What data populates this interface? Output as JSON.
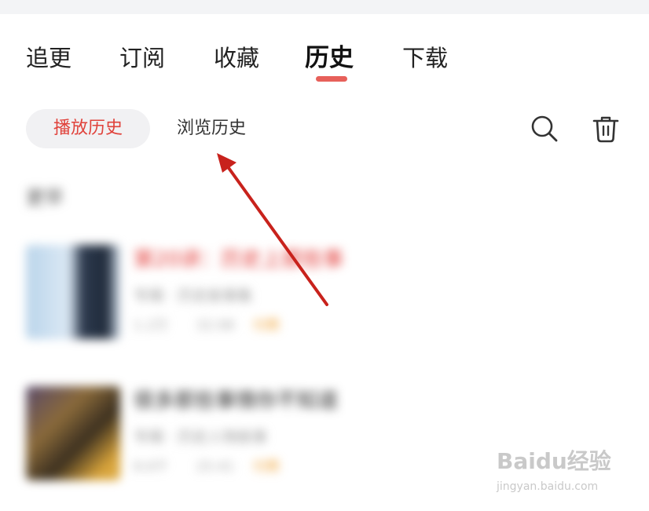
{
  "top_tabs": [
    {
      "label": "追更",
      "active": false
    },
    {
      "label": "订阅",
      "active": false
    },
    {
      "label": "收藏",
      "active": false
    },
    {
      "label": "历史",
      "active": true
    },
    {
      "label": "下载",
      "active": false
    }
  ],
  "sub_tabs": [
    {
      "label": "播放历史",
      "active": true
    },
    {
      "label": "浏览历史",
      "active": false
    }
  ],
  "toolbar": {
    "search_icon": "search-icon",
    "delete_icon": "trash-icon"
  },
  "history_section": {
    "label": "更早"
  },
  "history_items": [
    {
      "title": "第20讲：历史上那些事",
      "subtitle": "专辑 · 历史故事集",
      "plays": "1.2万",
      "duration": "32:08",
      "tag": "付费"
    },
    {
      "title": "很多那些事情你不知道",
      "subtitle": "专辑 · 历史人物故事",
      "plays": "8.6千",
      "duration": "25:41",
      "tag": "付费"
    }
  ],
  "watermark": {
    "brand": "Baidu经验",
    "url": "jingyan.baidu.com"
  },
  "colors": {
    "accent": "#e0423b",
    "indicator": "#e7605a",
    "arrow": "#c8221c"
  }
}
